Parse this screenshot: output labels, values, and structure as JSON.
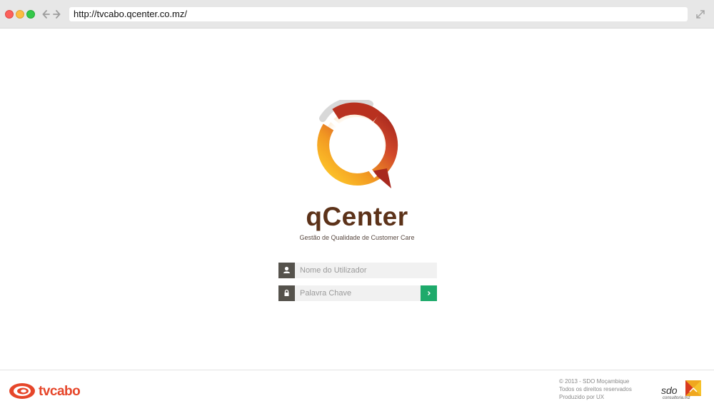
{
  "browser": {
    "url": "http://tvcabo.qcenter.co.mz/"
  },
  "app": {
    "brand_name": "qCenter",
    "tagline": "Gestão de Qualidade de Customer Care"
  },
  "login": {
    "username_placeholder": "Nome do Utilizador",
    "password_placeholder": "Palavra Chave",
    "submit_icon": "chevron-right-icon",
    "accent_color": "#1eaa6b"
  },
  "footer": {
    "partner_logo_text": "tvcabo",
    "credits": [
      "© 2013 - SDO Moçambique",
      "Todos os direitos reservados",
      "Produzido por UX"
    ],
    "sdo_logo_text": "sdo",
    "sdo_logo_subtext": "consultoria.mz"
  },
  "colors": {
    "brand_brown": "#5c3219",
    "brand_red": "#a8281e",
    "brand_orange": "#f08a1e",
    "footer_tvcabo": "#e6462a"
  }
}
